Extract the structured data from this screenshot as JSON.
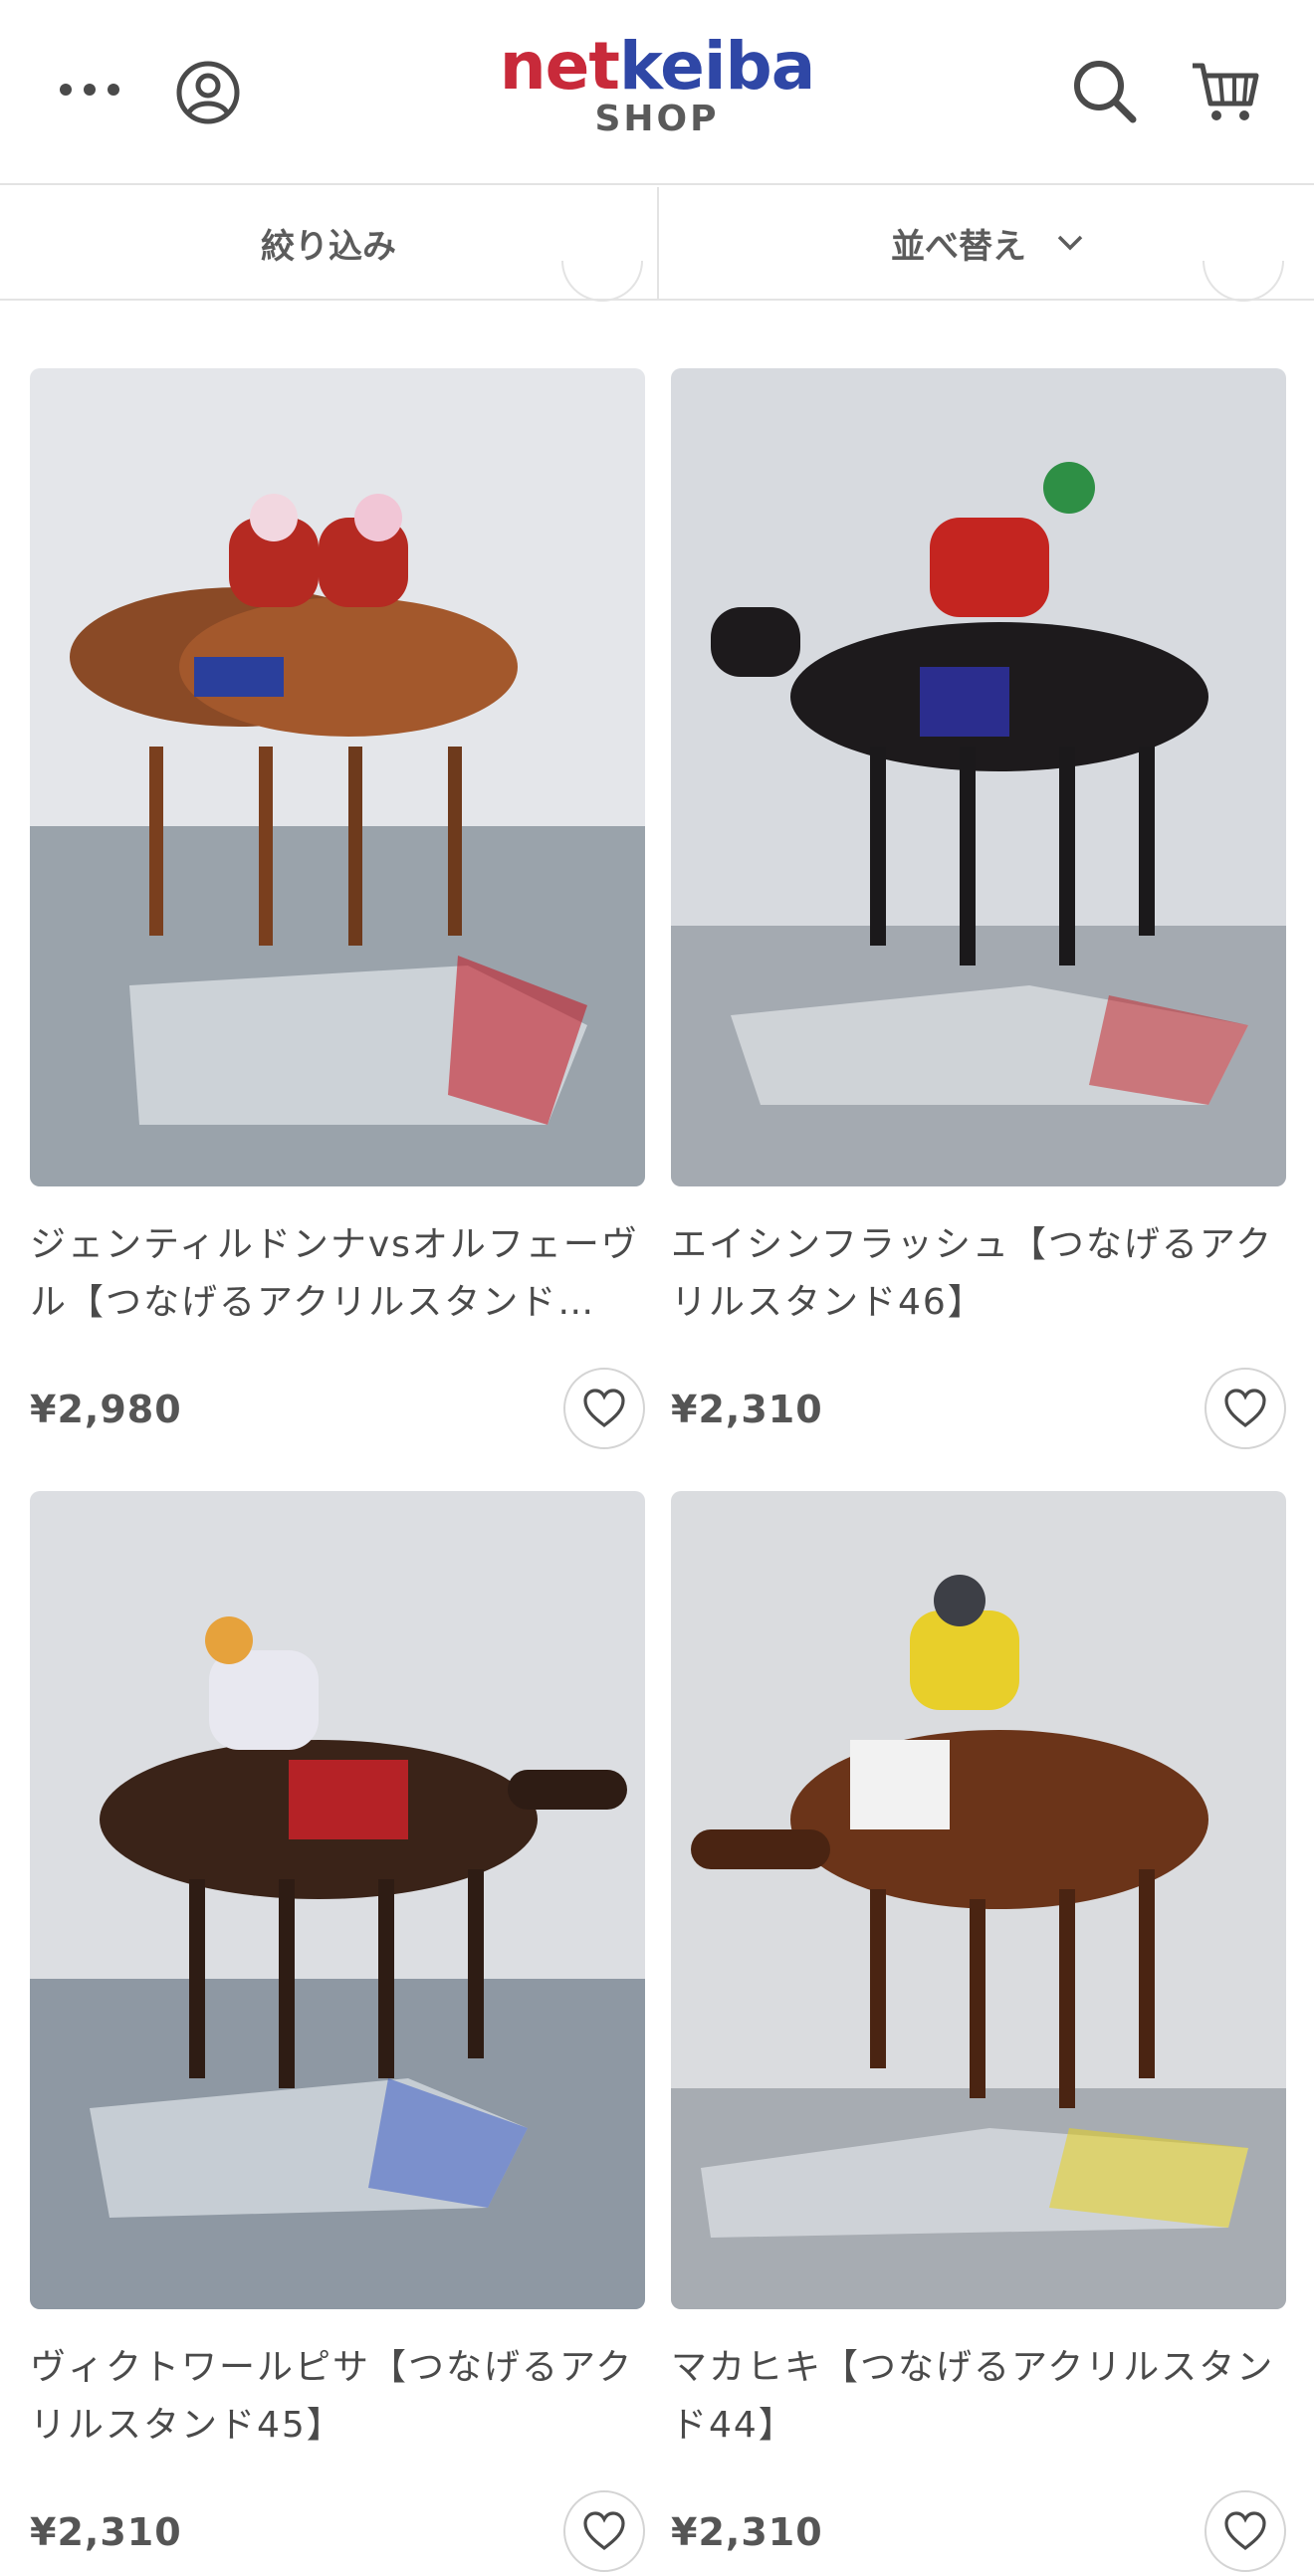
{
  "header": {
    "logo_net": "net",
    "logo_keiba": "keiba",
    "logo_sub": "SHOP",
    "brand_colors": {
      "net": "#c82a3a",
      "keiba": "#2f47a6"
    }
  },
  "toolbar": {
    "filter_label": "絞り込み",
    "sort_label": "並べ替え"
  },
  "products": [
    {
      "title": "ジェンティルドンナvsオルフェーヴル【つなげるアクリルスタンド…",
      "price": "¥2,980"
    },
    {
      "title": "エイシンフラッシュ【つなげるアクリルスタンド46】",
      "price": "¥2,310"
    },
    {
      "title": "ヴィクトワールピサ【つなげるアクリルスタンド45】",
      "price": "¥2,310"
    },
    {
      "title": "マカヒキ【つなげるアクリルスタンド44】",
      "price": "¥2,310"
    }
  ],
  "icons": [
    "more-dots-icon",
    "account-icon",
    "search-icon",
    "cart-icon",
    "chevron-down-icon",
    "heart-icon"
  ]
}
